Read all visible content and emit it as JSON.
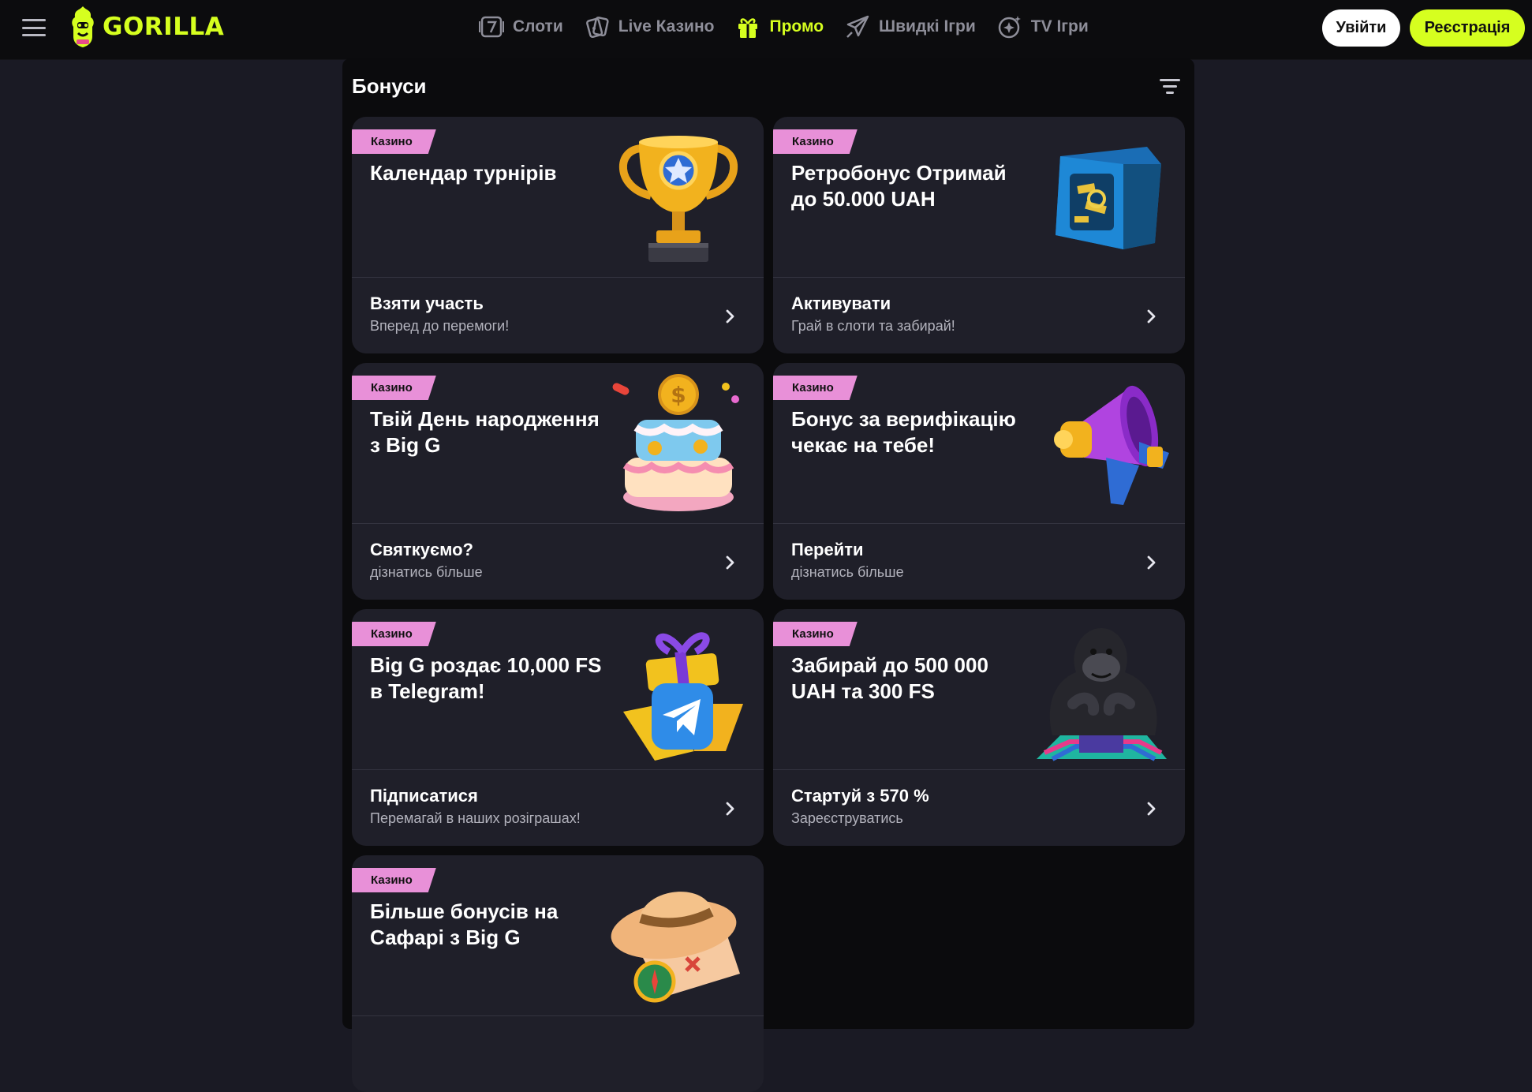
{
  "header": {
    "logo_text": "GORILLA",
    "nav": [
      {
        "label": "Слоти",
        "icon": "slot-seven-icon"
      },
      {
        "label": "Live Казино",
        "icon": "cards-icon"
      },
      {
        "label": "Промо",
        "icon": "gift-icon",
        "active": true
      },
      {
        "label": "Швидкі Ігри",
        "icon": "rocket-icon"
      },
      {
        "label": "TV Ігри",
        "icon": "tv-games-icon"
      }
    ],
    "login_label": "Увійти",
    "register_label": "Реєстрація"
  },
  "colors": {
    "accent": "#d6ff1f",
    "badge": "#e890d8",
    "card_bg": "#1f1f29",
    "page_bg": "#1a1a24"
  },
  "panel": {
    "title": "Бонуси"
  },
  "cards": [
    {
      "badge": "Казино",
      "title": "Календар турнірів",
      "cta": "Взяти участь",
      "sub": "Вперед до перемоги!",
      "art": "trophy"
    },
    {
      "badge": "Казино",
      "title": "Ретробонус Отримай до 50.000 UAH",
      "cta": "Активувати",
      "sub": "Грай в слоти та забирай!",
      "art": "safe"
    },
    {
      "badge": "Казино",
      "title": "Твій День народження з Big G",
      "cta": "Святкуємо?",
      "sub": "дізнатись більше",
      "art": "cake"
    },
    {
      "badge": "Казино",
      "title": "Бонус за верифікацію чекає на тебе!",
      "cta": "Перейти",
      "sub": "дізнатись більше",
      "art": "megaphone"
    },
    {
      "badge": "Казино",
      "title": "Big G роздає 10,000 FS в Telegram!",
      "cta": "Підписатися",
      "sub": "Перемагай в наших розіграшах!",
      "art": "telegram-gift"
    },
    {
      "badge": "Казино",
      "title": "Забирай до 500 000 UAH та 300 FS",
      "cta": "Стартуй з 570 %",
      "sub": "Зареєструватись",
      "art": "gorilla"
    },
    {
      "badge": "Казино",
      "title": "Більше бонусів на Сафарі з Big G",
      "cta": "",
      "sub": "",
      "art": "safari-hat"
    }
  ]
}
